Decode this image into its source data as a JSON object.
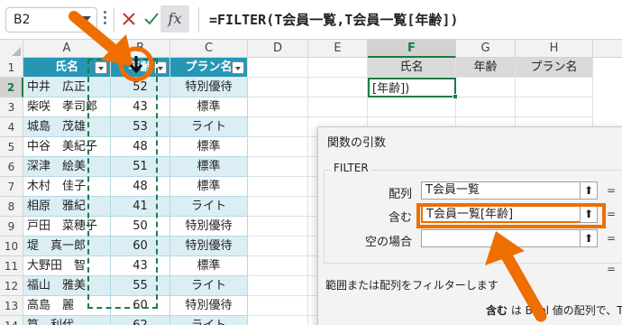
{
  "formula_bar": {
    "name_box": "B2",
    "fx_label": "fx",
    "formula": "=FILTER(T会員一覧,T会員一覧[年齢])"
  },
  "columns": [
    "A",
    "B",
    "C",
    "D",
    "E",
    "F",
    "G",
    "H"
  ],
  "selected_column": "F",
  "rows": [
    "1",
    "2",
    "3",
    "4",
    "5",
    "6",
    "7",
    "8",
    "9",
    "10",
    "11",
    "12",
    "13",
    "14"
  ],
  "selected_row": "2",
  "table": {
    "headers": [
      "氏名",
      "年齢",
      "プラン名"
    ],
    "records": [
      {
        "name": "中井　広正",
        "age": "52",
        "plan": "特別優待"
      },
      {
        "name": "柴咲　孝司郎",
        "age": "43",
        "plan": "標準"
      },
      {
        "name": "城島　茂雄",
        "age": "53",
        "plan": "ライト"
      },
      {
        "name": "中谷　美紀子",
        "age": "48",
        "plan": "標準"
      },
      {
        "name": "深津　絵美",
        "age": "51",
        "plan": "標準"
      },
      {
        "name": "木村　佳子",
        "age": "48",
        "plan": "標準"
      },
      {
        "name": "相原　雅紀",
        "age": "41",
        "plan": "ライト"
      },
      {
        "name": "戸田　菜穂子",
        "age": "50",
        "plan": "特別優待"
      },
      {
        "name": "堤　真一郎",
        "age": "60",
        "plan": "特別優待"
      },
      {
        "name": "大野田　智",
        "age": "43",
        "plan": "標準"
      },
      {
        "name": "福山　雅美",
        "age": "55",
        "plan": "ライト"
      },
      {
        "name": "高島　麗",
        "age": "60",
        "plan": "特別優待"
      },
      {
        "name": "筧　利代",
        "age": "62",
        "plan": "ライト"
      }
    ]
  },
  "output_headers": [
    "氏名",
    "年齢",
    "プラン名"
  ],
  "active_cell_value": "[年齢])",
  "dialog": {
    "title": "関数の引数",
    "function_name": "FILTER",
    "args": [
      {
        "label": "配列",
        "value": "T会員一覧"
      },
      {
        "label": "含む",
        "value": "T会員一覧[年齢]"
      },
      {
        "label": "空の場合",
        "value": ""
      }
    ],
    "collapse_glyph": "⬆",
    "equals": "=",
    "description": "範囲または配列をフィルターします",
    "arg_desc_name": "含む",
    "arg_desc_text": "は Bool 値の配列で、TR"
  },
  "colors": {
    "accent_orange": "#ee6e00",
    "excel_green": "#137e43",
    "table_header": "#2796b5",
    "table_band": "#dbeef4"
  }
}
